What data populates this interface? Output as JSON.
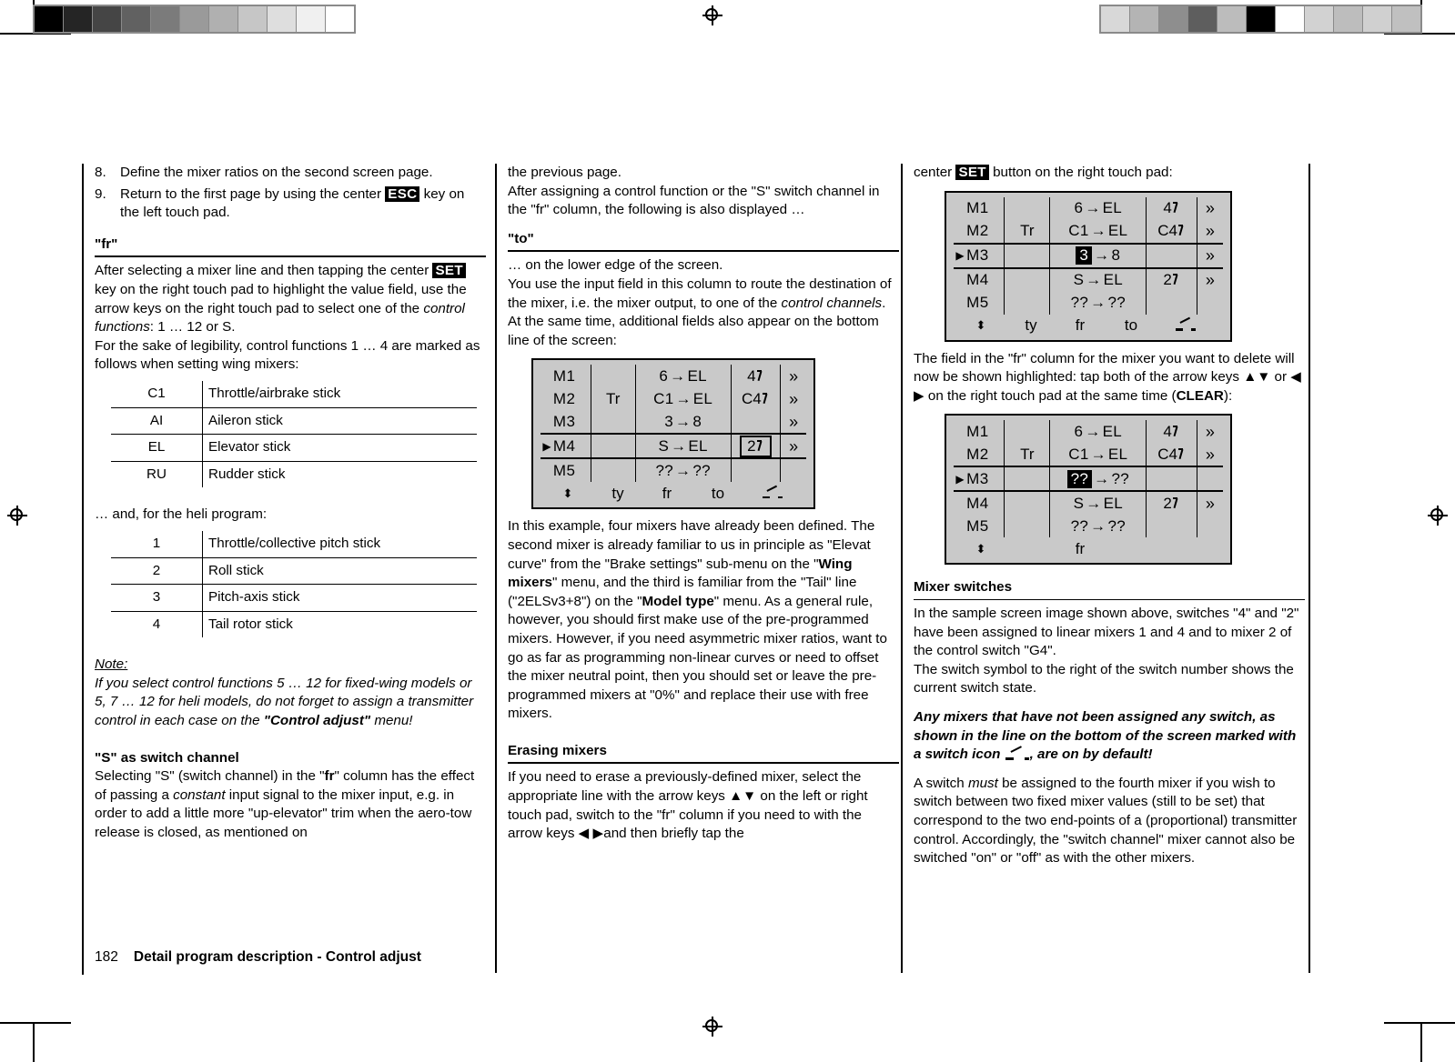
{
  "page": {
    "number": "182",
    "footer_title": "Detail program description - Control adjust"
  },
  "col1": {
    "steps": [
      {
        "n": "8.",
        "pre": "Define the mixer ratios on the second screen page.",
        "key": "",
        "post": ""
      },
      {
        "n": "9.",
        "pre": "Return to the first page by using the center ",
        "key": "ESC",
        "post": " key on the left touch pad."
      }
    ],
    "fr_heading": "\"fr\"",
    "fr_p1_a": "After selecting a mixer line and then tapping the center ",
    "fr_p1_key": "SET",
    "fr_p1_b": " key on the right touch pad to highlight the value field, use the arrow keys on the right touch pad to select one of the ",
    "fr_p1_i": "control functions",
    "fr_p1_c": ": 1 … 12 or S.",
    "fr_p2": "For the sake of legibility, control functions 1 … 4 are marked as follows when setting wing mixers:",
    "wing_table": [
      {
        "key": "C1",
        "desc": "Throttle/airbrake stick"
      },
      {
        "key": "AI",
        "desc": "Aileron stick"
      },
      {
        "key": "EL",
        "desc": "Elevator stick"
      },
      {
        "key": "RU",
        "desc": "Rudder stick"
      }
    ],
    "heli_intro": "… and, for the heli program:",
    "heli_table": [
      {
        "key": "1",
        "desc": "Throttle/collective pitch stick"
      },
      {
        "key": "2",
        "desc": "Roll stick"
      },
      {
        "key": "3",
        "desc": "Pitch-axis stick"
      },
      {
        "key": "4",
        "desc": "Tail rotor stick"
      }
    ],
    "note_label": "Note:",
    "note_a": "If you select control functions 5 … 12 for fixed-wing models or 5, 7 … 12 for heli models, do not forget to assign a transmitter control in each case on the ",
    "note_b": "\"Control adjust\"",
    "note_c": " menu!",
    "s_heading": "\"S\" as switch channel",
    "s_p_a": "Selecting \"S\" (switch channel) in the \"",
    "s_p_fr": "fr",
    "s_p_b": "\" column has the effect of passing a ",
    "s_p_i": "constant",
    "s_p_c": " input signal to the mixer input, e.g. in order to add a little more \"up-elevator\" trim when the aero-tow release is closed, as mentioned on"
  },
  "col2": {
    "p1": "the previous page.",
    "p2": "After assigning a control function or the \"S\" switch channel in the \"fr\" column, the following is also displayed …",
    "to_heading": "\"to\"",
    "p3": "… on the lower edge of the screen.",
    "p4_a": "You use the input field in this column to route the destination of the mixer, i.e. the mixer output, to one of the ",
    "p4_i": "control channels",
    "p4_b": ". At the same time, additional fields also appear on the bottom line of the screen:",
    "p5_a": "In this example, four mixers have already been defined. The second mixer is already familiar to us in principle as \"Elevat curve\" from the \"Brake settings\" sub-menu on the \"",
    "p5_b1": "Wing mixers",
    "p5_b": "\" menu, and the third is familiar from the \"Tail\" line (\"2ELSv3+8\") on the \"",
    "p5_b2": "Model type",
    "p5_c": "\" menu. As a general rule, however, you should first make use of the pre-programmed mixers. However, if you need asymmetric mixer ratios, want to go as far as programming non-linear curves or need to offset the mixer neutral point, then you should set or leave the pre-programmed mixers at \"0%\" and replace their use with free mixers.",
    "erase_heading": "Erasing mixers",
    "p6_a": "If you need to erase a previously-defined mixer, select the appropriate line with the arrow keys ",
    "p6_arrows1": "▲▼",
    "p6_b": " on the left or right touch pad, switch to the \"fr\" column if you need to with the arrow keys ",
    "p6_arrows2": "◀ ▶",
    "p6_c": "and then briefly tap the"
  },
  "col3": {
    "p1_a": "center ",
    "p1_key": "SET",
    "p1_b": " button on the right touch pad:",
    "p2_a": "The field in the \"fr\" column for the mixer you want to delete will now be shown highlighted: tap both of the arrow keys ",
    "p2_arrows1": "▲▼",
    "p2_mid": " or ",
    "p2_arrows2": "◀ ▶",
    "p2_b": " on the right touch pad at the same time (",
    "p2_clear": "CLEAR",
    "p2_c": "):",
    "sw_heading": "Mixer switches",
    "p3": "In the sample screen image shown above, switches \"4\" and \"2\" have been assigned to linear mixers 1 and 4 and to mixer 2 of the control switch \"G4\".",
    "p4": "The switch symbol to the right of the switch number shows the current switch state.",
    "p5_a": "Any mixers that have not been assigned any switch, as shown in the line on the bottom of the screen marked with a switch icon ",
    "p5_b": ", are on by default!",
    "p6_a": "A switch ",
    "p6_i": "must",
    "p6_b": " be assigned to the fourth mixer if you wish to switch between two fixed mixer values (still to be set) that correspond to the two end-points of a (proportional) transmitter control. Accordingly, the \"switch channel\" mixer cannot also be switched \"on\" or \"off\" as with the other mixers."
  },
  "lcd_labels": {
    "bottom_ud": "⬍",
    "bottom_ty": "ty",
    "bottom_fr": "fr",
    "bottom_to": "to",
    "arrow": "→"
  },
  "screens": {
    "screen_c2": {
      "rows": [
        {
          "marker": "",
          "mixer": "M1",
          "ty": "",
          "from": "6",
          "to": "EL",
          "sw": "4",
          "swicon": true,
          "chev": "»",
          "sel": false,
          "hl": "",
          "box": ""
        },
        {
          "marker": "",
          "mixer": "M2",
          "ty": "Tr",
          "from": "C1",
          "to": "EL",
          "sw": "C4",
          "swicon": true,
          "chev": "»",
          "sel": false,
          "hl": "",
          "box": ""
        },
        {
          "marker": "",
          "mixer": "M3",
          "ty": "",
          "from": "3",
          "to": "8",
          "sw": "",
          "swicon": false,
          "chev": "»",
          "sel": false,
          "hl": "",
          "box": ""
        },
        {
          "marker": "▶",
          "mixer": "M4",
          "ty": "",
          "from": "S",
          "to": "EL",
          "sw": "2",
          "swicon": true,
          "chev": "»",
          "sel": true,
          "hl": "",
          "box": "sw"
        },
        {
          "marker": "",
          "mixer": "M5",
          "ty": "",
          "from": "??",
          "to": "??",
          "sw": "",
          "swicon": false,
          "chev": "",
          "sel": false,
          "hl": "",
          "box": ""
        }
      ],
      "bottom": {
        "ty": "ty",
        "fr": "fr",
        "to": "to",
        "switch_icon": true
      }
    },
    "screen_c3_top": {
      "rows": [
        {
          "marker": "",
          "mixer": "M1",
          "ty": "",
          "from": "6",
          "to": "EL",
          "sw": "4",
          "swicon": true,
          "chev": "»",
          "sel": false,
          "hl": "",
          "box": ""
        },
        {
          "marker": "",
          "mixer": "M2",
          "ty": "Tr",
          "from": "C1",
          "to": "EL",
          "sw": "C4",
          "swicon": true,
          "chev": "»",
          "sel": false,
          "hl": "",
          "box": ""
        },
        {
          "marker": "▶",
          "mixer": "M3",
          "ty": "",
          "from": "3",
          "to": "8",
          "sw": "",
          "swicon": false,
          "chev": "»",
          "sel": true,
          "hl": "from",
          "box": ""
        },
        {
          "marker": "",
          "mixer": "M4",
          "ty": "",
          "from": "S",
          "to": "EL",
          "sw": "2",
          "swicon": true,
          "chev": "»",
          "sel": false,
          "hl": "",
          "box": ""
        },
        {
          "marker": "",
          "mixer": "M5",
          "ty": "",
          "from": "??",
          "to": "??",
          "sw": "",
          "swicon": false,
          "chev": "",
          "sel": false,
          "hl": "",
          "box": ""
        }
      ],
      "bottom": {
        "ty": "ty",
        "fr": "fr",
        "to": "to",
        "switch_icon": true
      }
    },
    "screen_c3_bottom": {
      "rows": [
        {
          "marker": "",
          "mixer": "M1",
          "ty": "",
          "from": "6",
          "to": "EL",
          "sw": "4",
          "swicon": true,
          "chev": "»",
          "sel": false,
          "hl": "",
          "box": ""
        },
        {
          "marker": "",
          "mixer": "M2",
          "ty": "Tr",
          "from": "C1",
          "to": "EL",
          "sw": "C4",
          "swicon": true,
          "chev": "»",
          "sel": false,
          "hl": "",
          "box": ""
        },
        {
          "marker": "▶",
          "mixer": "M3",
          "ty": "",
          "from": "??",
          "to": "??",
          "sw": "",
          "swicon": false,
          "chev": "",
          "sel": true,
          "hl": "from",
          "box": ""
        },
        {
          "marker": "",
          "mixer": "M4",
          "ty": "",
          "from": "S",
          "to": "EL",
          "sw": "2",
          "swicon": true,
          "chev": "»",
          "sel": false,
          "hl": "",
          "box": ""
        },
        {
          "marker": "",
          "mixer": "M5",
          "ty": "",
          "from": "??",
          "to": "??",
          "sw": "",
          "swicon": false,
          "chev": "",
          "sel": false,
          "hl": "",
          "box": ""
        }
      ],
      "bottom": {
        "ty": "",
        "fr": "fr",
        "to": "",
        "switch_icon": false
      }
    }
  },
  "calibration": {
    "left_swatches": [
      "#000000",
      "#252525",
      "#454545",
      "#616161",
      "#7b7b7b",
      "#9a9a9a",
      "#b0b0b0",
      "#c6c6c6",
      "#dedede",
      "#f0f0f0",
      "#ffffff"
    ],
    "right_swatches": [
      "#d8d8d8",
      "#b4b4b4",
      "#8e8e8e",
      "#5e5e5e",
      "#bcbcbc",
      "#000000",
      "#ffffff",
      "#d2d2d2",
      "#bdbdbd",
      "#d0d0d0",
      "#c0c0c0"
    ]
  }
}
